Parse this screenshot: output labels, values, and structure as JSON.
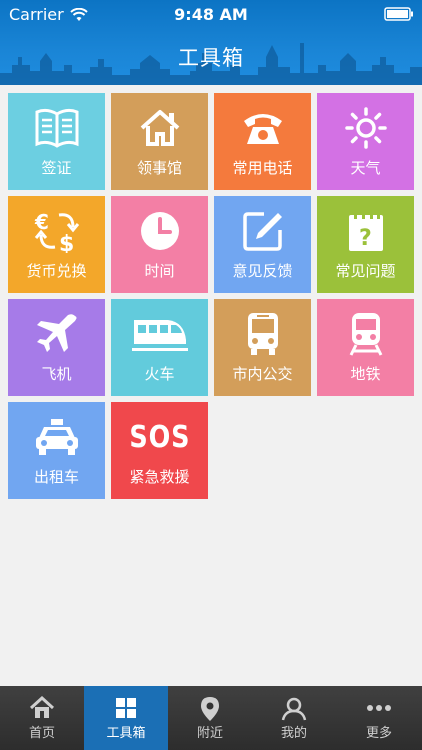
{
  "status": {
    "carrier": "Carrier",
    "time": "9:48 AM"
  },
  "nav": {
    "title": "工具箱"
  },
  "tiles": [
    {
      "label": "签证",
      "icon": "book-icon",
      "color": "#6ccfe1"
    },
    {
      "label": "领事馆",
      "icon": "house-icon",
      "color": "#d39e5a"
    },
    {
      "label": "常用电话",
      "icon": "telephone-icon",
      "color": "#f47a3d"
    },
    {
      "label": "天气",
      "icon": "sun-icon",
      "color": "#d371e4"
    },
    {
      "label": "货币兑换",
      "icon": "currency-exchange-icon",
      "color": "#f3a72a"
    },
    {
      "label": "时间",
      "icon": "clock-icon",
      "color": "#f37fa5"
    },
    {
      "label": "意见反馈",
      "icon": "edit-icon",
      "color": "#71a6f1"
    },
    {
      "label": "常见问题",
      "icon": "question-note-icon",
      "color": "#9bc13a"
    },
    {
      "label": "飞机",
      "icon": "airplane-icon",
      "color": "#a67be8"
    },
    {
      "label": "火车",
      "icon": "train-icon",
      "color": "#62cbdc"
    },
    {
      "label": "市内公交",
      "icon": "bus-icon",
      "color": "#d39e5a"
    },
    {
      "label": "地铁",
      "icon": "subway-icon",
      "color": "#f37fa5"
    },
    {
      "label": "出租车",
      "icon": "taxi-icon",
      "color": "#71a6f1"
    },
    {
      "label": "紧急救援",
      "icon": "sos-icon",
      "color": "#f0484c",
      "icon_text": "SOS"
    }
  ],
  "tabs": [
    {
      "label": "首页",
      "icon": "home-icon",
      "active": false
    },
    {
      "label": "工具箱",
      "icon": "grid-icon",
      "active": true
    },
    {
      "label": "附近",
      "icon": "location-pin-icon",
      "active": false
    },
    {
      "label": "我的",
      "icon": "user-icon",
      "active": false
    },
    {
      "label": "更多",
      "icon": "more-dots-icon",
      "active": false
    }
  ]
}
